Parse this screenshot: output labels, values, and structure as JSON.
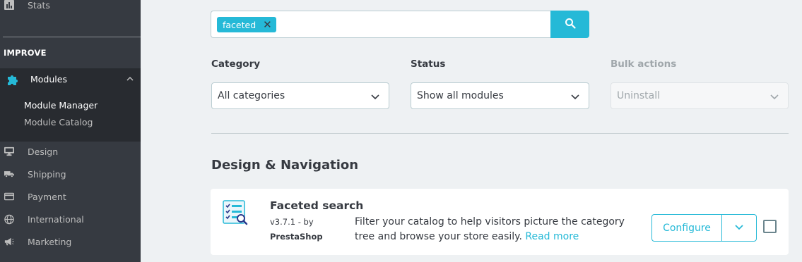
{
  "sidebar": {
    "stats": {
      "label": "Stats",
      "icon": "bar-chart-icon"
    },
    "section_title": "IMPROVE",
    "modules": {
      "label": "Modules",
      "icon": "puzzle-icon",
      "accent": "#25b9d7"
    },
    "submenu": [
      "Module Manager",
      "Module Catalog"
    ],
    "items": [
      {
        "label": "Design",
        "icon": "monitor-icon"
      },
      {
        "label": "Shipping",
        "icon": "truck-icon"
      },
      {
        "label": "Payment",
        "icon": "credit-card-icon"
      },
      {
        "label": "International",
        "icon": "globe-icon"
      },
      {
        "label": "Marketing",
        "icon": "megaphone-icon"
      }
    ]
  },
  "search": {
    "tag": "faceted",
    "accent": "#25b9d7"
  },
  "filters": {
    "category": {
      "label": "Category",
      "value": "All categories"
    },
    "status": {
      "label": "Status",
      "value": "Show all modules"
    },
    "bulk": {
      "label": "Bulk actions",
      "value": "Uninstall"
    }
  },
  "section_title": "Design & Navigation",
  "module": {
    "title": "Faceted search",
    "version": "v3.7.1 - by",
    "author": "PrestaShop",
    "description": "Filter your catalog to help visitors picture the category tree and browse your store easily.",
    "read_more": "Read more",
    "configure_label": "Configure"
  }
}
